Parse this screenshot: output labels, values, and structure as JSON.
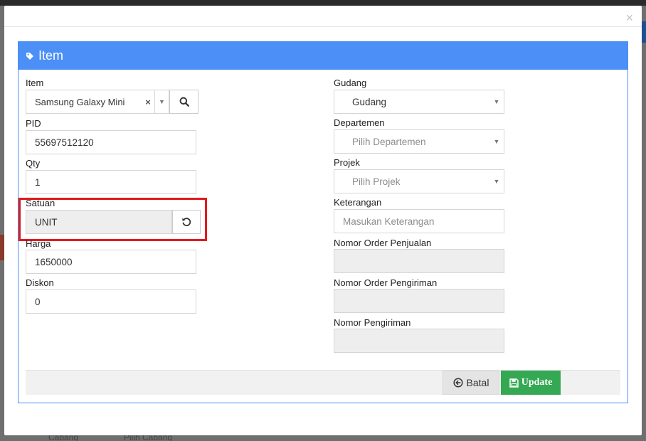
{
  "modal": {
    "close_symbol": "×",
    "panel_title": "Item"
  },
  "left": {
    "item": {
      "label": "Item",
      "value": "Samsung Galaxy Mini",
      "clear": "×"
    },
    "pid": {
      "label": "PID",
      "value": "55697512120"
    },
    "qty": {
      "label": "Qty",
      "value": "1"
    },
    "satuan": {
      "label": "Satuan",
      "value": "UNIT"
    },
    "harga": {
      "label": "Harga",
      "value": "1650000"
    },
    "diskon": {
      "label": "Diskon",
      "value": "0"
    }
  },
  "right": {
    "gudang": {
      "label": "Gudang",
      "value": "Gudang"
    },
    "departemen": {
      "label": "Departemen",
      "placeholder": "Pilih Departemen"
    },
    "projek": {
      "label": "Projek",
      "placeholder": "Pilih Projek"
    },
    "keterangan": {
      "label": "Keterangan",
      "placeholder": "Masukan Keterangan"
    },
    "nomor_order_penjualan": {
      "label": "Nomor Order Penjualan",
      "value": ""
    },
    "nomor_order_pengiriman": {
      "label": "Nomor Order Pengiriman",
      "value": ""
    },
    "nomor_pengiriman": {
      "label": "Nomor Pengiriman",
      "value": ""
    }
  },
  "footer": {
    "batal_label": "Batal",
    "update_label": "Update"
  },
  "background": {
    "cabang_label": "Cabang",
    "cabang_placeholder": "Pilih Cabang"
  },
  "colors": {
    "panel_header": "#4b8ff7",
    "update_button": "#34a853",
    "highlight": "#e11b1b"
  }
}
